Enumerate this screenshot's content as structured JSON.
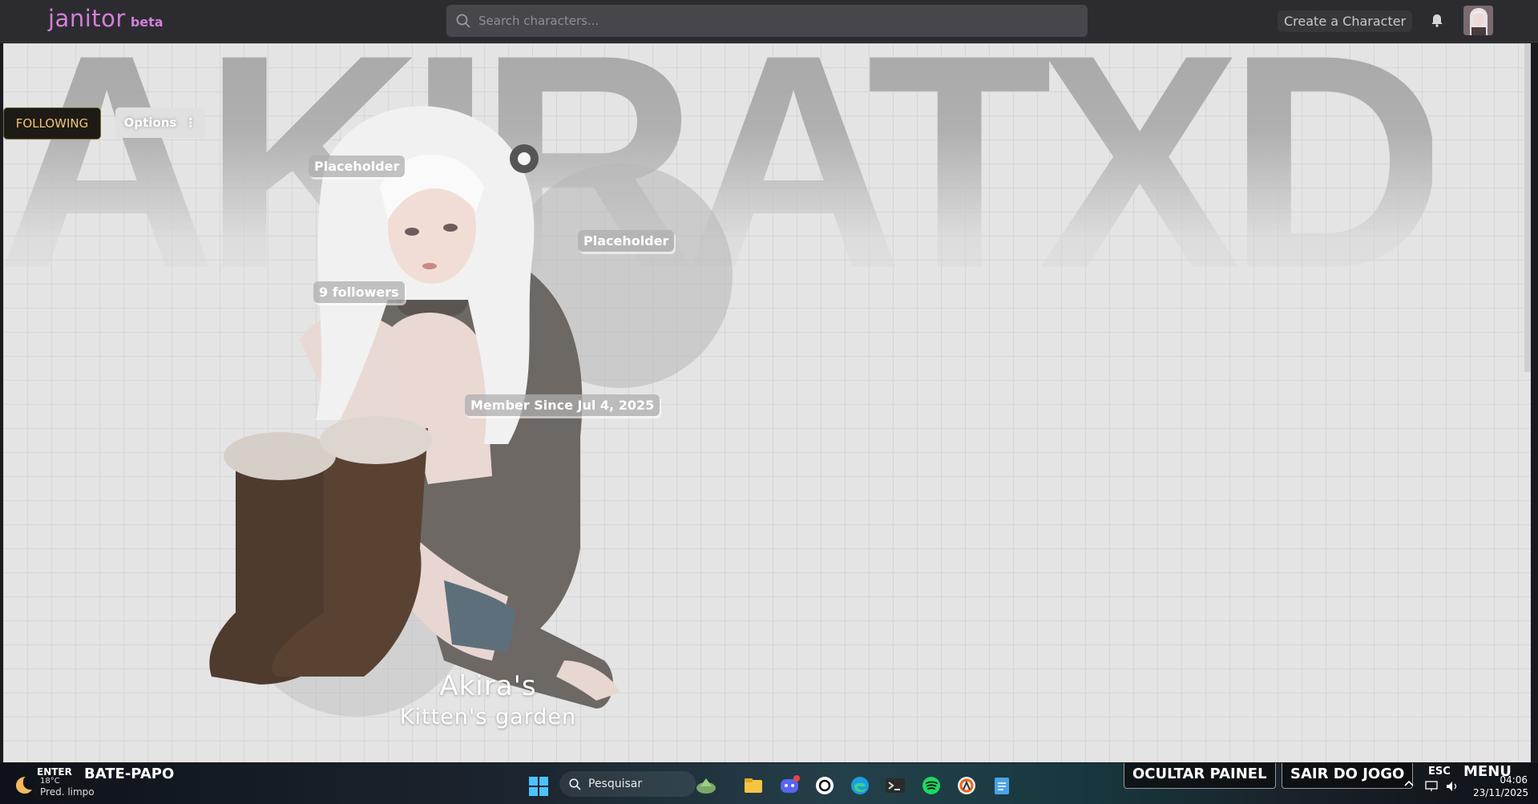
{
  "header": {
    "logo": "janitor",
    "logo_badge": "beta",
    "search_placeholder": "Search characters...",
    "create_label": "Create a Character"
  },
  "profile": {
    "background_name": "AKIRATXD",
    "following_label": "FOLLOWING",
    "options_label": "Options",
    "tags": [
      "Placeholder",
      "Placeholder"
    ],
    "followers": "9 followers",
    "member_since": "Member Since Jul 4, 2025",
    "title_line1": "Akira's",
    "title_line2": "Kitten's garden"
  },
  "taskbar": {
    "enter_label": "ENTER",
    "temperature": "18°C",
    "weather": "Pred. limpo",
    "chat_label": "BATE-PAPO",
    "search_label": "Pesquisar",
    "hide_panel_label": "OCULTAR PAINEL",
    "exit_game_label": "SAIR DO JOGO",
    "esc_label": "ESC",
    "menu_label": "MENU",
    "time": "04:06",
    "date": "23/11/2025"
  },
  "colors": {
    "logo": "#d37fd9",
    "following_text": "#f2c572",
    "navbar": "#2c2c30",
    "profile_bg": "#e4e4e4"
  }
}
